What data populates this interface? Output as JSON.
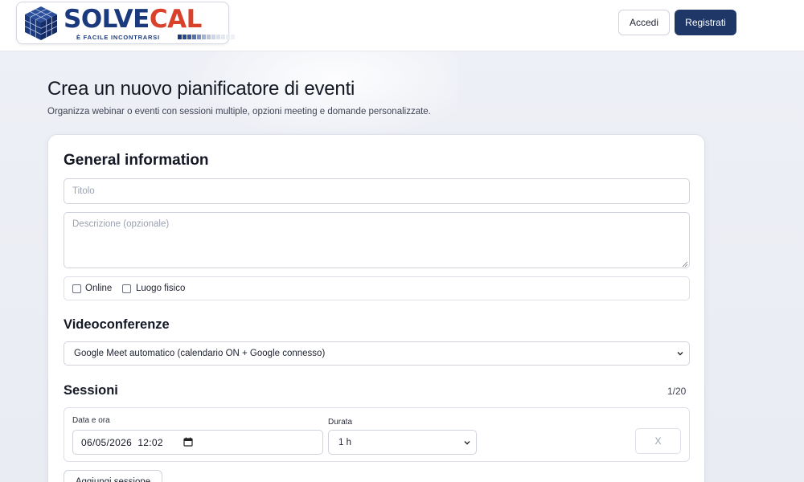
{
  "brand": {
    "name_part1": "SOLVE",
    "name_part2": "CAL",
    "tagline": "È FACILE INCONTRARSI",
    "colors": {
      "primary": "#1b3a7e",
      "accent": "#d9412b"
    },
    "logo_icon": "cube-grid-icon"
  },
  "header": {
    "login_label": "Accedi",
    "register_label": "Registrati"
  },
  "page": {
    "title": "Crea un nuovo pianificatore di eventi",
    "subtitle": "Organizza webinar o eventi con sessioni multiple, opzioni meeting e domande personalizzate."
  },
  "general": {
    "heading": "General information",
    "title_placeholder": "Titolo",
    "title_value": "",
    "description_placeholder": "Descrizione (opzionale)",
    "description_value": "",
    "online_label": "Online",
    "online_checked": false,
    "physical_label": "Luogo fisico",
    "physical_checked": false
  },
  "video": {
    "heading": "Videoconferenze",
    "selected": "Google Meet automatico (calendario ON + Google connesso)"
  },
  "sessions": {
    "heading": "Sessioni",
    "count": "1/20",
    "items": [
      {
        "datetime_label": "Data e ora",
        "datetime_value": "06/05/2026  12:02",
        "duration_label": "Durata",
        "duration_value": "1 h",
        "remove_label": "X"
      }
    ],
    "add_label": "Aggiungi sessione"
  }
}
